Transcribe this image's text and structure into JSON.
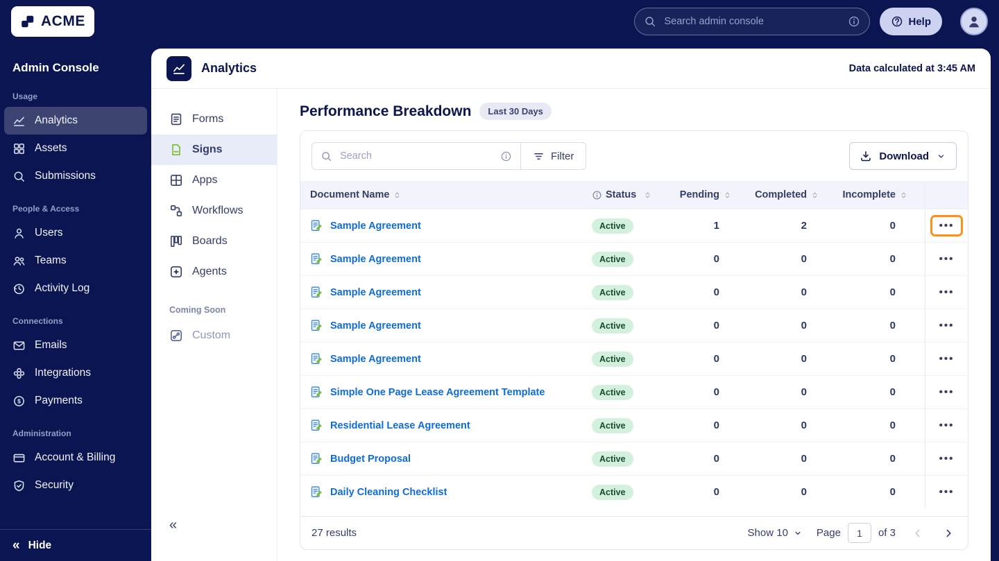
{
  "colors": {
    "navy": "#0a1551",
    "link": "#0f6bd6",
    "badgeBg": "#d3f0dd",
    "badgeText": "#164b2e",
    "highlight": "#ff9016",
    "signGreen": "#7abb2a",
    "sidebarActive": "#3d4472",
    "navActive": "#e8ebf8",
    "headerBg": "#f3f4fb"
  },
  "icons": {
    "ellipsis": "•••",
    "collapse": "«"
  },
  "topbar": {
    "logo_text": "ACME",
    "search_placeholder": "Search admin console",
    "help_label": "Help"
  },
  "sidebar": {
    "title": "Admin Console",
    "hide_label": "Hide",
    "sections": [
      {
        "label": "Usage",
        "items": [
          {
            "label": "Analytics",
            "icon": "chart",
            "active": true
          },
          {
            "label": "Assets",
            "icon": "grid"
          },
          {
            "label": "Submissions",
            "icon": "search"
          }
        ]
      },
      {
        "label": "People & Access",
        "items": [
          {
            "label": "Users",
            "icon": "user"
          },
          {
            "label": "Teams",
            "icon": "users"
          },
          {
            "label": "Activity Log",
            "icon": "clock"
          }
        ]
      },
      {
        "label": "Connections",
        "items": [
          {
            "label": "Emails",
            "icon": "mail"
          },
          {
            "label": "Integrations",
            "icon": "flower"
          },
          {
            "label": "Payments",
            "icon": "dollar"
          }
        ]
      },
      {
        "label": "Administration",
        "items": [
          {
            "label": "Account & Billing",
            "icon": "card"
          },
          {
            "label": "Security",
            "icon": "shield"
          }
        ]
      }
    ]
  },
  "panel": {
    "title": "Analytics",
    "data_calculated": "Data calculated at 3:45 AM",
    "nav": {
      "items": [
        {
          "label": "Forms",
          "icon": "form"
        },
        {
          "label": "Signs",
          "icon": "sign",
          "active": true
        },
        {
          "label": "Apps",
          "icon": "apps"
        },
        {
          "label": "Workflows",
          "icon": "flow"
        },
        {
          "label": "Boards",
          "icon": "board"
        },
        {
          "label": "Agents",
          "icon": "agent"
        }
      ],
      "coming_soon_label": "Coming Soon",
      "coming_soon_items": [
        {
          "label": "Custom",
          "icon": "custom"
        }
      ]
    },
    "content": {
      "heading": "Performance Breakdown",
      "badge": "Last 30 Days",
      "search_placeholder": "Search",
      "filter_label": "Filter",
      "download_label": "Download",
      "table": {
        "columns": [
          "Document Name",
          "Status",
          "Pending",
          "Completed",
          "Incomplete"
        ],
        "rows": [
          {
            "name": "Sample Agreement",
            "status": "Active",
            "pending": "1",
            "completed": "2",
            "incomplete": "0",
            "highlight": true
          },
          {
            "name": "Sample Agreement",
            "status": "Active",
            "pending": "0",
            "completed": "0",
            "incomplete": "0"
          },
          {
            "name": "Sample Agreement",
            "status": "Active",
            "pending": "0",
            "completed": "0",
            "incomplete": "0"
          },
          {
            "name": "Sample Agreement",
            "status": "Active",
            "pending": "0",
            "completed": "0",
            "incomplete": "0"
          },
          {
            "name": "Sample Agreement",
            "status": "Active",
            "pending": "0",
            "completed": "0",
            "incomplete": "0"
          },
          {
            "name": "Simple One Page Lease Agreement Template",
            "status": "Active",
            "pending": "0",
            "completed": "0",
            "incomplete": "0"
          },
          {
            "name": "Residential Lease Agreement",
            "status": "Active",
            "pending": "0",
            "completed": "0",
            "incomplete": "0"
          },
          {
            "name": "Budget Proposal",
            "status": "Active",
            "pending": "0",
            "completed": "0",
            "incomplete": "0"
          },
          {
            "name": "Daily Cleaning Checklist",
            "status": "Active",
            "pending": "0",
            "completed": "0",
            "incomplete": "0"
          }
        ]
      },
      "footer": {
        "results": "27 results",
        "show_label": "Show 10",
        "page_label": "Page",
        "page_value": "1",
        "of_label": "of 3"
      }
    }
  }
}
